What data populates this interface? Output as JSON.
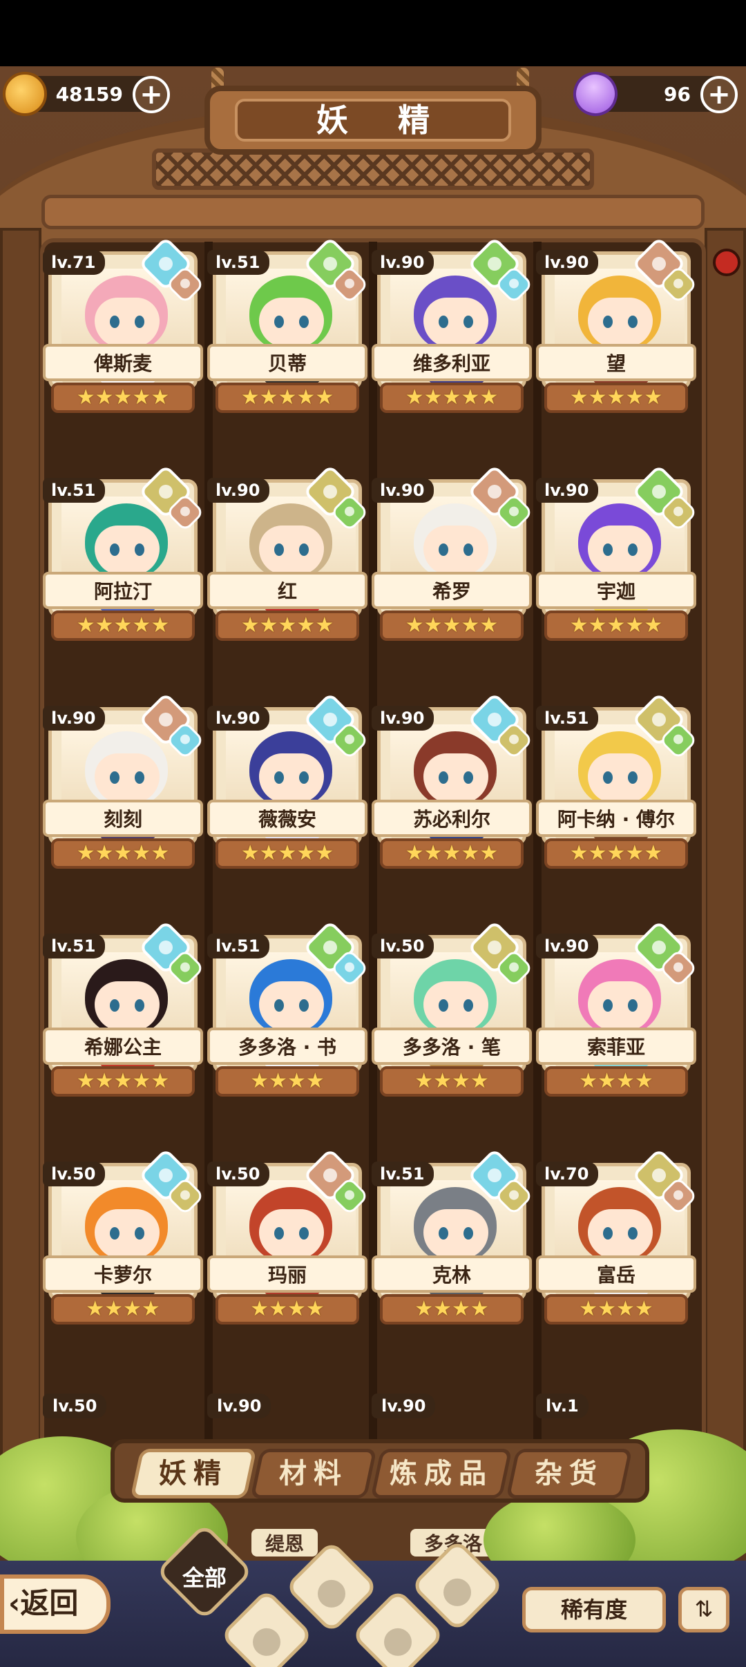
{
  "header": {
    "title": "妖 精",
    "coins": "48159",
    "gems": "96",
    "plus": "+"
  },
  "fairies": [
    {
      "level": "lv.71",
      "name": "俾斯麦",
      "stars": "★★★★★",
      "element": "water",
      "sub": "fire",
      "hair": "#f4a9b9",
      "outfit": "#ffffff"
    },
    {
      "level": "lv.51",
      "name": "贝蒂",
      "stars": "★★★★★",
      "element": "leaf",
      "sub": "fire",
      "hair": "#6ec94b",
      "outfit": "#2f2f2f"
    },
    {
      "level": "lv.90",
      "name": "维多利亚",
      "stars": "★★★★★",
      "element": "leaf",
      "sub": "water",
      "hair": "#6a4fc7",
      "outfit": "#3d3d8c"
    },
    {
      "level": "lv.90",
      "name": "望",
      "stars": "★★★★★",
      "element": "fire",
      "sub": "stone",
      "hair": "#f1b53a",
      "outfit": "#8c3a2a"
    },
    {
      "level": "lv.51",
      "name": "阿拉汀",
      "stars": "★★★★★",
      "element": "stone",
      "sub": "fire",
      "hair": "#2aa88c",
      "outfit": "#4a62c2"
    },
    {
      "level": "lv.90",
      "name": "红",
      "stars": "★★★★★",
      "element": "stone",
      "sub": "leaf",
      "hair": "#cdb48a",
      "outfit": "#c22a2a"
    },
    {
      "level": "lv.90",
      "name": "希罗",
      "stars": "★★★★★",
      "element": "fire",
      "sub": "leaf",
      "hair": "#f2efe9",
      "outfit": "#b0862b"
    },
    {
      "level": "lv.90",
      "name": "宇迦",
      "stars": "★★★★★",
      "element": "leaf",
      "sub": "stone",
      "hair": "#7a4ad8",
      "outfit": "#f1d54a"
    },
    {
      "level": "lv.90",
      "name": "刻刻",
      "stars": "★★★★★",
      "element": "fire",
      "sub": "water",
      "hair": "#f2efea",
      "outfit": "#4a3a6a"
    },
    {
      "level": "lv.90",
      "name": "薇薇安",
      "stars": "★★★★★",
      "element": "water",
      "sub": "leaf",
      "hair": "#3b3f9a",
      "outfit": "#e8e8f6"
    },
    {
      "level": "lv.90",
      "name": "苏必利尔",
      "stars": "★★★★★",
      "element": "water",
      "sub": "stone",
      "hair": "#8a3a2a",
      "outfit": "#2b3f8a"
    },
    {
      "level": "lv.51",
      "name": "阿卡纳 · 傅尔",
      "stars": "★★★★★",
      "element": "stone",
      "sub": "leaf",
      "hair": "#f2c94a",
      "outfit": "#7a4a2a"
    },
    {
      "level": "lv.51",
      "name": "希娜公主",
      "stars": "★★★★★",
      "element": "water",
      "sub": "leaf",
      "hair": "#2a1a1a",
      "outfit": "#c23a2a"
    },
    {
      "level": "lv.51",
      "name": "多多洛 · 书",
      "stars": "★★★★",
      "element": "leaf",
      "sub": "water",
      "hair": "#2b7ad8",
      "outfit": "#f4f4f4"
    },
    {
      "level": "lv.50",
      "name": "多多洛 · 笔",
      "stars": "★★★★",
      "element": "stone",
      "sub": "leaf",
      "hair": "#6ed4a8",
      "outfit": "#b88a4a"
    },
    {
      "level": "lv.90",
      "name": "索菲亚",
      "stars": "★★★★",
      "element": "leaf",
      "sub": "fire",
      "hair": "#f07ab8",
      "outfit": "#8ad4d4"
    },
    {
      "level": "lv.50",
      "name": "卡萝尔",
      "stars": "★★★★",
      "element": "water",
      "sub": "stone",
      "hair": "#f28a2a",
      "outfit": "#2a2a2a"
    },
    {
      "level": "lv.50",
      "name": "玛丽",
      "stars": "★★★★",
      "element": "fire",
      "sub": "leaf",
      "hair": "#c2442a",
      "outfit": "#b03a2a"
    },
    {
      "level": "lv.51",
      "name": "克林",
      "stars": "★★★★",
      "element": "water",
      "sub": "stone",
      "hair": "#7a7f86",
      "outfit": "#5a5f66"
    },
    {
      "level": "lv.70",
      "name": "富岳",
      "stars": "★★★★",
      "element": "stone",
      "sub": "fire",
      "hair": "#c2542a",
      "outfit": "#f4f4f4"
    }
  ],
  "partial_row": {
    "levels": [
      "lv.50",
      "lv.90",
      "lv.90",
      "lv.1"
    ],
    "names": [
      "缇恩",
      "多多洛 · 日"
    ]
  },
  "tabs": [
    "妖精",
    "材料",
    "炼成品",
    "杂货"
  ],
  "filters": {
    "all": "全部"
  },
  "buttons": {
    "back": "返回",
    "sort": "稀有度",
    "order_icon": "⇅"
  },
  "colors": {
    "water": "#7ad4e6",
    "leaf": "#86cd5e",
    "stone": "#cfc06a",
    "fire": "#d39a7a"
  },
  "icons": [
    "coin-icon",
    "gem-icon",
    "water-element-icon",
    "leaf-element-icon",
    "stone-element-icon",
    "fire-element-icon",
    "sort-order-icon"
  ]
}
